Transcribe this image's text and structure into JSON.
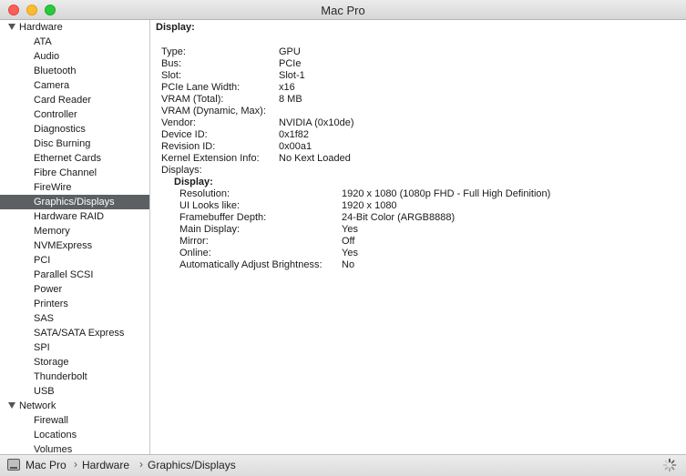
{
  "window": {
    "title": "Mac Pro"
  },
  "sidebar": {
    "groups": [
      {
        "label": "Hardware",
        "items": [
          "ATA",
          "Audio",
          "Bluetooth",
          "Camera",
          "Card Reader",
          "Controller",
          "Diagnostics",
          "Disc Burning",
          "Ethernet Cards",
          "Fibre Channel",
          "FireWire",
          "Graphics/Displays",
          "Hardware RAID",
          "Memory",
          "NVMExpress",
          "PCI",
          "Parallel SCSI",
          "Power",
          "Printers",
          "SAS",
          "SATA/SATA Express",
          "SPI",
          "Storage",
          "Thunderbolt",
          "USB"
        ]
      },
      {
        "label": "Network",
        "items": [
          "Firewall",
          "Locations",
          "Volumes"
        ]
      }
    ],
    "selected": "Graphics/Displays"
  },
  "main": {
    "section_title": "Display:",
    "properties": [
      {
        "key": "Type:",
        "value": "GPU"
      },
      {
        "key": "Bus:",
        "value": "PCIe"
      },
      {
        "key": "Slot:",
        "value": "Slot-1"
      },
      {
        "key": "PCIe Lane Width:",
        "value": "x16"
      },
      {
        "key": "VRAM (Total):",
        "value": "8 MB"
      },
      {
        "key": "VRAM (Dynamic, Max):",
        "value": ""
      },
      {
        "key": "Vendor:",
        "value": "NVIDIA (0x10de)"
      },
      {
        "key": "Device ID:",
        "value": "0x1f82"
      },
      {
        "key": "Revision ID:",
        "value": "0x00a1"
      },
      {
        "key": "Kernel Extension Info:",
        "value": "No Kext Loaded"
      },
      {
        "key": "Displays:",
        "value": ""
      }
    ],
    "display_title": "Display:",
    "display_properties": [
      {
        "key": "Resolution:",
        "value": "1920 x 1080 (1080p FHD - Full High Definition)"
      },
      {
        "key": "UI Looks like:",
        "value": "1920 x 1080"
      },
      {
        "key": "Framebuffer Depth:",
        "value": "24-Bit Color (ARGB8888)"
      },
      {
        "key": "Main Display:",
        "value": "Yes"
      },
      {
        "key": "Mirror:",
        "value": "Off"
      },
      {
        "key": "Online:",
        "value": "Yes"
      },
      {
        "key": "Automatically Adjust Brightness:",
        "value": "No"
      }
    ]
  },
  "statusbar": {
    "path": [
      "Mac Pro",
      "Hardware",
      "Graphics/Displays"
    ],
    "separator": "›"
  }
}
